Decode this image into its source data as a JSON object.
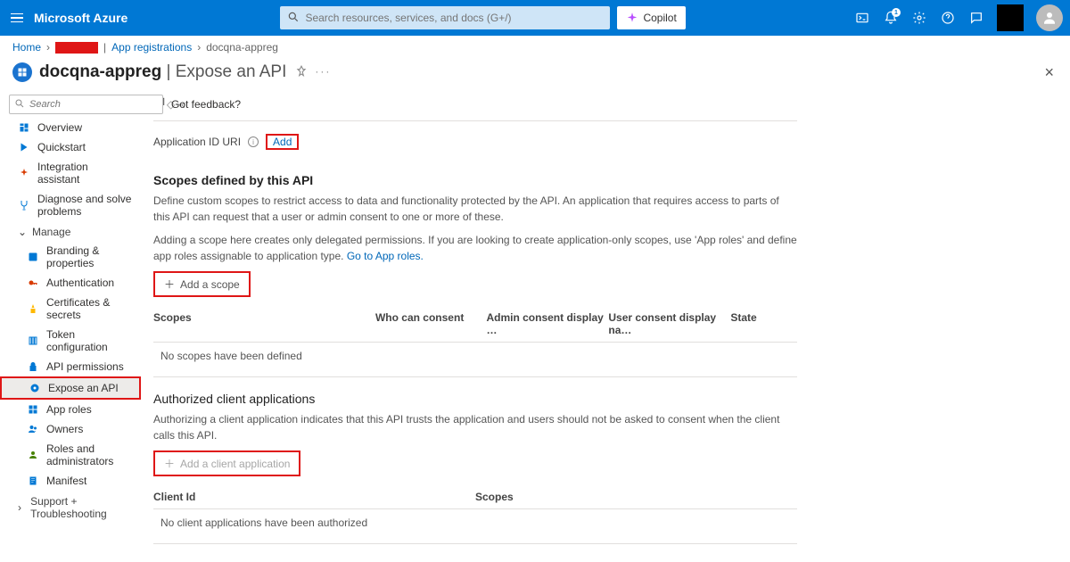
{
  "header": {
    "brand": "Microsoft Azure",
    "search_placeholder": "Search resources, services, and docs (G+/)",
    "copilot_label": "Copilot",
    "notification_count": "1"
  },
  "breadcrumb": {
    "home": "Home",
    "app_reg": "App registrations",
    "current": "docqna-appreg"
  },
  "page": {
    "title_main": "docqna-appreg",
    "title_sub": " | Expose an API",
    "feedback": "Got feedback?"
  },
  "sidebar": {
    "search_placeholder": "Search",
    "items": {
      "overview": "Overview",
      "quickstart": "Quickstart",
      "integration": "Integration assistant",
      "diagnose": "Diagnose and solve problems",
      "manage": "Manage",
      "branding": "Branding & properties",
      "authentication": "Authentication",
      "certificates": "Certificates & secrets",
      "token": "Token configuration",
      "api_perm": "API permissions",
      "expose": "Expose an API",
      "app_roles": "App roles",
      "owners": "Owners",
      "roles_admin": "Roles and administrators",
      "manifest": "Manifest",
      "support": "Support + Troubleshooting"
    }
  },
  "content": {
    "appid_label": "Application ID URI",
    "appid_add": "Add",
    "scopes_heading": "Scopes defined by this API",
    "scopes_desc1": "Define custom scopes to restrict access to data and functionality protected by the API. An application that requires access to parts of this API can request that a user or admin consent to one or more of these.",
    "scopes_desc2a": "Adding a scope here creates only delegated permissions. If you are looking to create application-only scopes, use 'App roles' and define app roles assignable to application type. ",
    "scopes_desc2_link": "Go to App roles.",
    "add_scope_btn": "Add a scope",
    "scopes_table": {
      "col_scopes": "Scopes",
      "col_who": "Who can consent",
      "col_admin": "Admin consent display …",
      "col_user": "User consent display na…",
      "col_state": "State"
    },
    "scopes_empty": "No scopes have been defined",
    "clients_heading": "Authorized client applications",
    "clients_desc": "Authorizing a client application indicates that this API trusts the application and users should not be asked to consent when the client calls this API.",
    "add_client_btn": "Add a client application",
    "clients_table": {
      "col_clientid": "Client Id",
      "col_scopes": "Scopes"
    },
    "clients_empty": "No client applications have been authorized"
  }
}
